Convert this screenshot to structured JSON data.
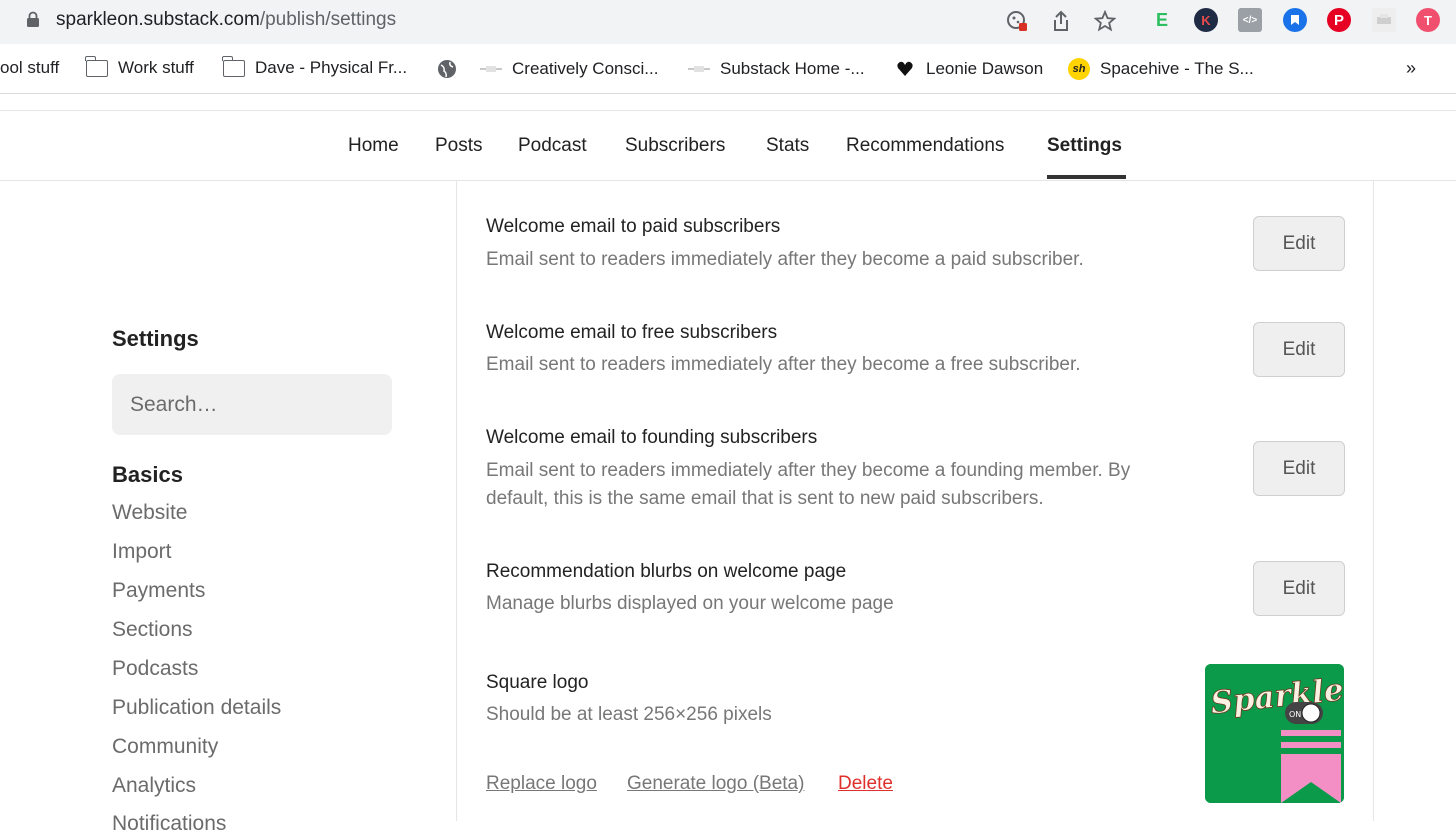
{
  "browser": {
    "url_host": "sparkleon.substack.com",
    "url_path": "/publish/settings",
    "bookmarks": [
      {
        "label": "ool stuff",
        "icon": "none"
      },
      {
        "label": "Work stuff",
        "icon": "folder-icon"
      },
      {
        "label": "Dave - Physical Fr...",
        "icon": "folder-icon"
      },
      {
        "label": "",
        "icon": "globe-icon"
      },
      {
        "label": "Creatively Consci...",
        "icon": "site-favicon"
      },
      {
        "label": "Substack Home -...",
        "icon": "site-favicon"
      },
      {
        "label": "Leonie Dawson",
        "icon": "heart-favicon"
      },
      {
        "label": "Spacehive - The S...",
        "icon": "spacehive-favicon"
      }
    ],
    "more_label": "»",
    "extensions": [
      {
        "name": "evernote-icon",
        "letter": "E",
        "color": "#2dbe60"
      },
      {
        "name": "k-extension-icon",
        "letter": "K",
        "color": "#1f2a44"
      },
      {
        "name": "code-extension-icon",
        "letter": "</>",
        "color": "#9aa0a6"
      },
      {
        "name": "bookmark-extension-icon",
        "letter": "",
        "color": "#1a73e8"
      },
      {
        "name": "pinterest-icon",
        "letter": "P",
        "color": "#e60023"
      },
      {
        "name": "printer-extension-icon",
        "letter": "",
        "color": "#cfcfcf"
      },
      {
        "name": "pink-extension-icon",
        "letter": "T",
        "color": "#f0506e"
      }
    ]
  },
  "nav": {
    "items": [
      "Home",
      "Posts",
      "Podcast",
      "Subscribers",
      "Stats",
      "Recommendations",
      "Settings"
    ],
    "active": "Settings"
  },
  "sidebar": {
    "title": "Settings",
    "search_placeholder": "Search…",
    "section_heading": "Basics",
    "links": [
      "Website",
      "Import",
      "Payments",
      "Sections",
      "Podcasts",
      "Publication details",
      "Community",
      "Analytics",
      "Notifications"
    ]
  },
  "settings_rows": [
    {
      "title": "Welcome email to paid subscribers",
      "description": "Email sent to readers immediately after they become a paid subscriber.",
      "button": "Edit"
    },
    {
      "title": "Welcome email to free subscribers",
      "description": "Email sent to readers immediately after they become a free subscriber.",
      "button": "Edit"
    },
    {
      "title": "Welcome email to founding subscribers",
      "description": "Email sent to readers immediately after they become a founding member. By default, this is the same email that is sent to new paid subscribers.",
      "button": "Edit"
    },
    {
      "title": "Recommendation blurbs on welcome page",
      "description": "Manage blurbs displayed on your welcome page",
      "button": "Edit"
    }
  ],
  "square_logo": {
    "title": "Square logo",
    "description": "Should be at least 256×256 pixels",
    "actions": {
      "replace": "Replace logo",
      "generate": "Generate logo (Beta)",
      "delete": "Delete"
    },
    "logo_text": "Sparkle",
    "toggle_text": "ON",
    "colors": {
      "background": "#0a9a4a",
      "accent": "#f48fc6",
      "text": "#fbf1e3"
    }
  },
  "colors": {
    "danger": "#e0302b",
    "muted_text": "#777777"
  }
}
